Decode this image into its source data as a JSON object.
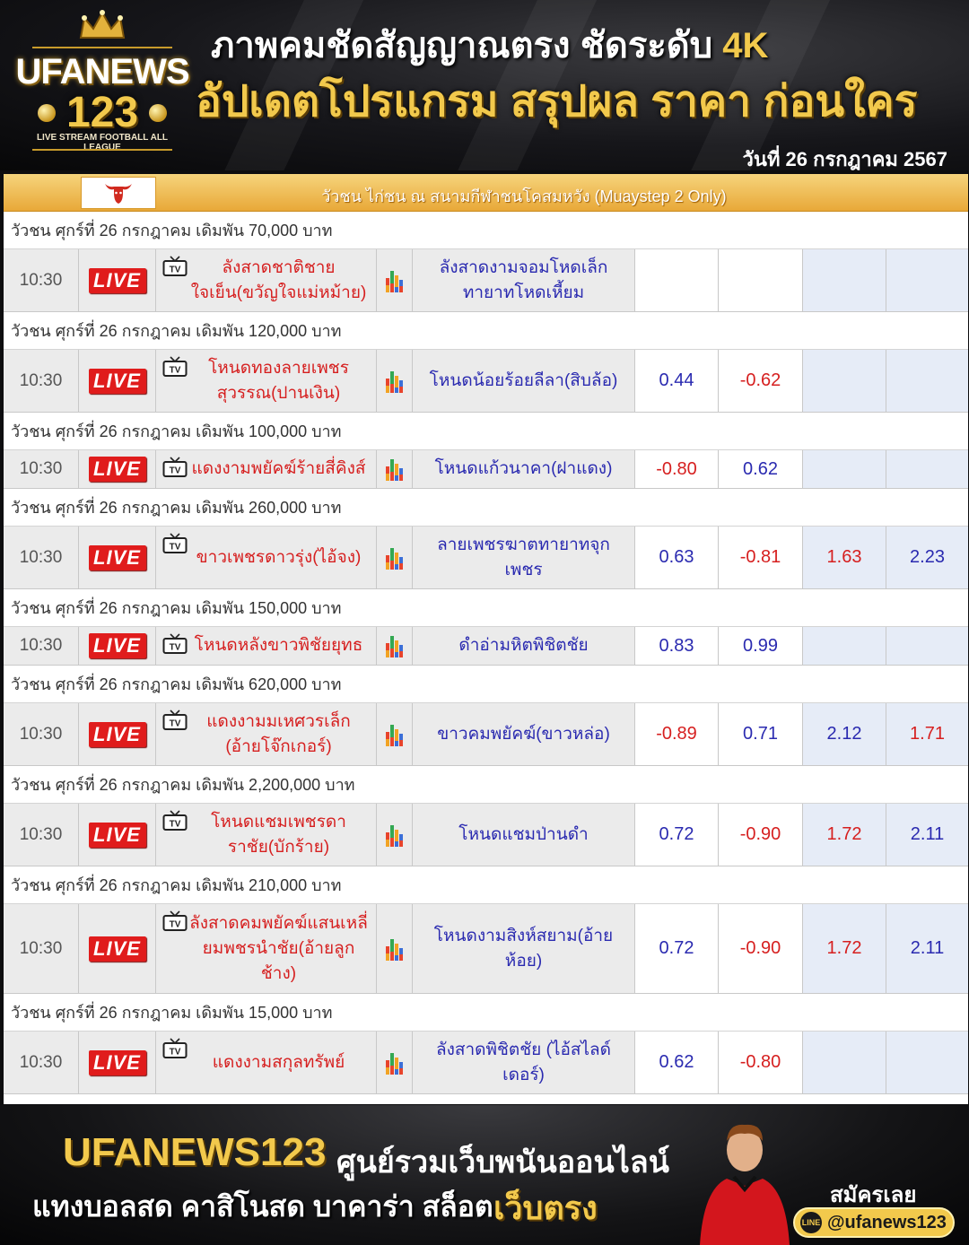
{
  "header": {
    "headline_1": "ภาพคมชัดสัญญาณตรง ชัดระดับ",
    "headline_1_gold": "4K",
    "headline_2": "อัปเดตโปรแกรม สรุปผล ราคา ก่อนใคร",
    "date": "วันที่ 26 กรกฎาคม 2567",
    "logo": {
      "brand_top": "UFANEWS",
      "brand_bottom": "123",
      "tagline": "LIVE STREAM FOOTBALL ALL LEAGUE"
    }
  },
  "league": {
    "title": "วัวชน ไก่ชน ณ สนามกีฬาชนโคสมหวัง (Muaystep 2 Only)",
    "icon": "bull-head-icon"
  },
  "matches": [
    {
      "group": "วัวชน ศุกร์ที่ 26 กรกฎาคม เดิมพัน 70,000 บาท",
      "time": "10:30",
      "live": "LIVE",
      "home": "ลังสาดชาติชาย ใจเย็น(ขวัญใจแม่หม้าย)",
      "away": "ลังสาดงามจอมโหดเล็ก ทายาทโหดเหี้ยม",
      "o1": "",
      "o2": "",
      "o3": "",
      "o4": "",
      "c1": "blue",
      "c2": "blue",
      "c3": "blue",
      "c4": "blue"
    },
    {
      "group": "วัวชน ศุกร์ที่ 26 กรกฎาคม เดิมพัน 120,000 บาท",
      "time": "10:30",
      "live": "LIVE",
      "home": "โหนดทองลายเพชร สุวรรณ(ปานเงิน)",
      "away": "โหนดน้อยร้อยลีลา(สิบล้อ)",
      "o1": "0.44",
      "o2": "-0.62",
      "o3": "",
      "o4": "",
      "c1": "blue",
      "c2": "red",
      "c3": "blue",
      "c4": "blue"
    },
    {
      "group": "วัวชน ศุกร์ที่ 26 กรกฎาคม เดิมพัน 100,000 บาท",
      "time": "10:30",
      "live": "LIVE",
      "home": "แดงงามพยัคฆ์ร้ายสี่คิงส์",
      "away": "โหนดแก้วนาคา(ฝาแดง)",
      "o1": "-0.80",
      "o2": "0.62",
      "o3": "",
      "o4": "",
      "c1": "red",
      "c2": "blue",
      "c3": "blue",
      "c4": "blue"
    },
    {
      "group": "วัวชน ศุกร์ที่ 26 กรกฎาคม เดิมพัน 260,000 บาท",
      "time": "10:30",
      "live": "LIVE",
      "home": "ขาวเพชรดาวรุ่ง(ไอ้จง)",
      "away": "ลายเพชรฆาตทายาทจุกเพชร",
      "o1": "0.63",
      "o2": "-0.81",
      "o3": "1.63",
      "o4": "2.23",
      "c1": "blue",
      "c2": "red",
      "c3": "red",
      "c4": "blue"
    },
    {
      "group": "วัวชน ศุกร์ที่ 26 กรกฎาคม เดิมพัน 150,000 บาท",
      "time": "10:30",
      "live": "LIVE",
      "home": "โหนดหลังขาวพิชัยยุทธ",
      "away": "ดำอ่ามหิตพิชิตชัย",
      "o1": "0.83",
      "o2": "0.99",
      "o3": "",
      "o4": "",
      "c1": "blue",
      "c2": "blue",
      "c3": "blue",
      "c4": "blue"
    },
    {
      "group": "วัวชน ศุกร์ที่ 26 กรกฎาคม เดิมพัน 620,000 บาท",
      "time": "10:30",
      "live": "LIVE",
      "home": "แดงงามมเหศวรเล็ก (อ้ายโจ๊กเกอร์)",
      "away": "ขาวคมพยัคฆ์(ขาวหล่อ)",
      "o1": "-0.89",
      "o2": "0.71",
      "o3": "2.12",
      "o4": "1.71",
      "c1": "red",
      "c2": "blue",
      "c3": "blue",
      "c4": "red"
    },
    {
      "group": "วัวชน ศุกร์ที่ 26 กรกฎาคม เดิมพัน 2,200,000 บาท",
      "time": "10:30",
      "live": "LIVE",
      "home": "โหนดแชมเพชรดา ราชัย(บักร้าย)",
      "away": "โหนดแชมป่านดำ",
      "o1": "0.72",
      "o2": "-0.90",
      "o3": "1.72",
      "o4": "2.11",
      "c1": "blue",
      "c2": "red",
      "c3": "red",
      "c4": "blue"
    },
    {
      "group": "วัวชน ศุกร์ที่ 26 กรกฎาคม เดิมพัน 210,000 บาท",
      "time": "10:30",
      "live": "LIVE",
      "home": "ลังสาดคมพยัคฆ์แสนเหลี่ยมพชรนำชัย(อ้ายลูกช้าง)",
      "away": "โหนดงามสิงห์สยาม(อ้ายห้อย)",
      "o1": "0.72",
      "o2": "-0.90",
      "o3": "1.72",
      "o4": "2.11",
      "c1": "blue",
      "c2": "red",
      "c3": "red",
      "c4": "blue"
    },
    {
      "group": "วัวชน ศุกร์ที่ 26 กรกฎาคม เดิมพัน 15,000 บาท",
      "time": "10:30",
      "live": "LIVE",
      "home": "แดงงามสกุลทรัพย์",
      "away": "ลังสาดพิชิตชัย (ไอ้สไลด์เดอร์)",
      "o1": "0.62",
      "o2": "-0.80",
      "o3": "",
      "o4": "",
      "c1": "blue",
      "c2": "red",
      "c3": "blue",
      "c4": "blue"
    }
  ],
  "footer": {
    "brand": "UFANEWS123",
    "tagline": "ศูนย์รวมเว็บพนันออนไลน์",
    "services": "แทงบอลสด คาสิโนสด บาคาร่า สล็อต",
    "highlight": "เว็บตรง",
    "signup": "สมัครเลย",
    "line_handle": "@ufanews123",
    "line_icon_text": "LINE"
  },
  "colors": {
    "gold": "#f2c94c",
    "live_red": "#e01c1c",
    "home_red": "#d61f1f",
    "away_blue": "#2a2ab0",
    "league_orange": "#e8a838"
  }
}
